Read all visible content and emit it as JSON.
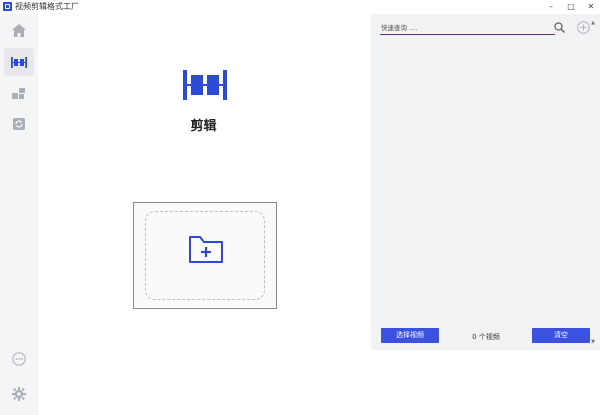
{
  "window": {
    "title": "视频剪辑格式工厂",
    "minimize": "–",
    "maximize": "□",
    "close": "✕"
  },
  "sidebar": {
    "items": [
      {
        "name": "home",
        "icon": "home-icon",
        "active": false
      },
      {
        "name": "clip",
        "icon": "clip-icon",
        "active": true
      },
      {
        "name": "merge",
        "icon": "blocks-icon",
        "active": false
      },
      {
        "name": "convert",
        "icon": "convert-icon",
        "active": false
      }
    ],
    "more_icon": "more-icon",
    "settings_icon": "gear-icon"
  },
  "main": {
    "feature_label": "剪辑",
    "dropzone_icon": "folder-add-icon"
  },
  "panel": {
    "search": {
      "placeholder": "快速查询 ...."
    },
    "select_button": "选择视频",
    "count": "0 个视频",
    "clear_button": "清空"
  },
  "colors": {
    "accent": "#3b51e0",
    "sidebar_bg": "#f4f5f7",
    "panel_bg": "#f1f2f4",
    "search_underline": "#6b2a7a"
  }
}
